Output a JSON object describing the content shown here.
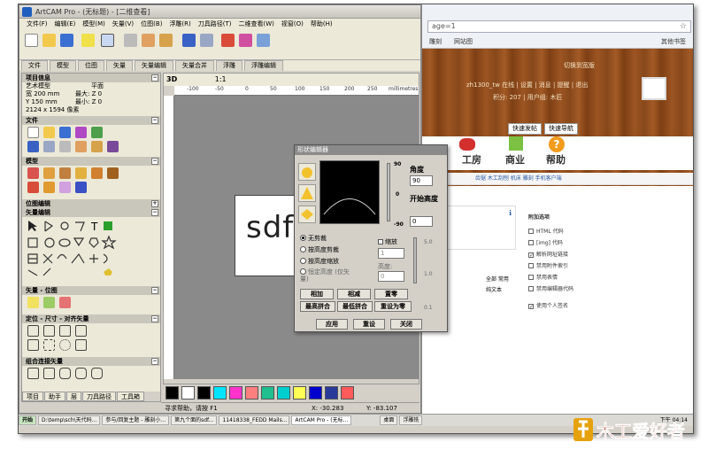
{
  "artcam": {
    "title": "ArtCAM Pro - (无标题) - [二维查看]",
    "menu": [
      "文件(F)",
      "编辑(E)",
      "模型(M)",
      "矢量(V)",
      "位图(B)",
      "浮雕(R)",
      "刀具路径(T)",
      "二维查看(W)",
      "视窗(O)",
      "帮助(H)"
    ],
    "tabs": [
      "文件",
      "模型",
      "位图",
      "矢量",
      "矢量编辑",
      "矢量合并",
      "浮雕",
      "浮雕编辑"
    ],
    "panel": {
      "project_section": "项目信息",
      "art_model": "艺术模型",
      "plane": "平面",
      "width": "宽 200 mm",
      "height": "Y 150 mm",
      "zmax": "最大: Z 0",
      "zmin": "最小: Z 0",
      "pixels": "2124 x 1594 像素",
      "sec_file": "文件",
      "sec_model": "模型",
      "sec_bitmap_edit": "位图编辑",
      "sec_vector_edit": "矢量编辑",
      "sec_vector_bitmap": "矢量 - 位图",
      "sec_position": "定位 - 尺寸 - 对齐矢量",
      "sec_combine": "组合连接矢量",
      "bottom_tabs": [
        "项目",
        "助手",
        "层",
        "刀具路径",
        "工具箱"
      ]
    },
    "view": {
      "label": "3D",
      "zoom": "1:1",
      "ruler_ticks": [
        "-100",
        "-50",
        "0",
        "50",
        "100",
        "150",
        "200",
        "250"
      ],
      "ruler_units": "millimetres",
      "canvas_text": "sdf"
    },
    "status": {
      "hint": "寻求帮助，请按 F1",
      "x": "X: -30.283",
      "y": "Y: -83.107"
    },
    "palette_colors": [
      "#000000",
      "#ffffff",
      "#000000",
      "#00e5ff",
      "#ff33cc",
      "#ff7f7f",
      "#1fbf8f",
      "#00cfcf",
      "#ffff55",
      "#0000cc",
      "#2a3a9a",
      "#ff5a5a"
    ]
  },
  "dialog": {
    "title": "形状编辑器",
    "angle_label": "角度",
    "angle_value": "90",
    "angle_scale": [
      "90",
      "0",
      "-90"
    ],
    "start_height_label": "开始高度",
    "start_height_value": "0",
    "scale_label": "缩放",
    "scale_value": "1",
    "height_label": "高度:",
    "height_value": "0",
    "scale_ticks": [
      "5.0",
      "1.0",
      "0.1"
    ],
    "radios": [
      "无剪裁",
      "按高度剪裁",
      "按高度缩放",
      "恒定高度 (仅矢量)"
    ],
    "selected_radio": 0,
    "buttons_row1": [
      "相加",
      "相减",
      "置零"
    ],
    "buttons_row2": [
      "最高拼合",
      "最低拼合",
      "重设为零"
    ],
    "buttons_row3": [
      "应用",
      "重设",
      "关闭"
    ]
  },
  "browser": {
    "url": "age=1",
    "bookmarks": [
      "雕刻",
      "网站图",
      "其他书签"
    ],
    "user_line": "zh1300_tw 在线 | 设置 | 消息 | 提醒 | 退出",
    "credit_line": "积分: 207 | 用户组: 木匠",
    "tool_line": "切换到宽版",
    "nav_buttons": [
      "快速发帖",
      "快速导航"
    ],
    "menu_items": [
      "工房",
      "商业",
      "帮助"
    ],
    "sub_nav": "齿锯  木工刮刨  机床  雕刻    手机客户端",
    "attach_header": "附加选项",
    "options": [
      {
        "label": "HTML 代码",
        "checked": false
      },
      {
        "label": "[img] 代码",
        "checked": false
      },
      {
        "label": "解析网址链接",
        "checked": true
      },
      {
        "label": "禁用附件索引",
        "checked": false
      },
      {
        "label": "禁用表情",
        "checked": false
      },
      {
        "label": "禁用编辑器代码",
        "checked": false
      },
      {
        "label": "使用个人签名",
        "checked": true
      }
    ],
    "editor_note": "全部  常用",
    "plain_text": "纯文本"
  },
  "taskbar": {
    "start": "开始",
    "tasks": [
      "D:\\temp\\sch\\天代码...",
      "参与/回复主题 - 雕刻小...",
      "第九个面的sdf...",
      "11418338_FEDD Mails...",
      "ArtCAM Pro - (无标...",
      "桌面",
      "浮雕铣"
    ],
    "clock": "下午 04:14"
  },
  "logo_text": "木工爱好者"
}
